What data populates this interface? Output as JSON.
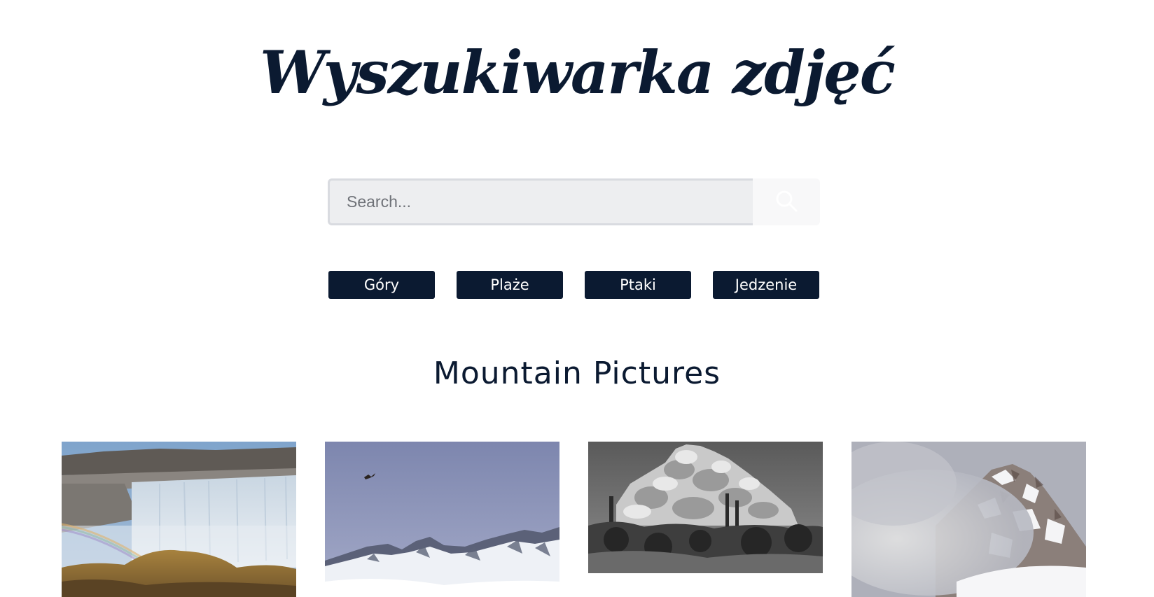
{
  "header": {
    "title": "Wyszukiwarka zdjęć"
  },
  "search": {
    "placeholder": "Search...",
    "value": "",
    "button_icon": "search-icon"
  },
  "categories": [
    {
      "label": "Góry"
    },
    {
      "label": "Plaże"
    },
    {
      "label": "Ptaki"
    },
    {
      "label": "Jedzenie"
    }
  ],
  "gallery": {
    "title": "Mountain Pictures",
    "photos": [
      {
        "subject": "waterfall-with-rainbow"
      },
      {
        "subject": "snowy-peaks-with-bird"
      },
      {
        "subject": "black-and-white-boulders"
      },
      {
        "subject": "misty-snowy-mountain"
      }
    ]
  },
  "colors": {
    "brand_dark": "#0b1a31",
    "search_bg": "#edeef0",
    "search_border": "#d9dbe0",
    "page_bg": "#ffffff"
  }
}
